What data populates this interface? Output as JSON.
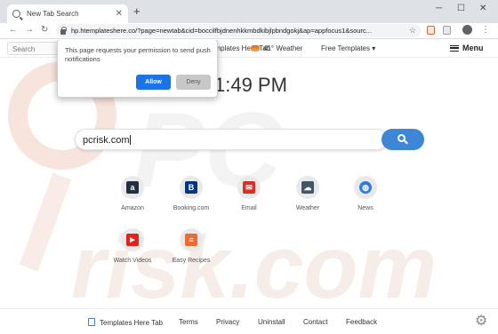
{
  "browser": {
    "tab_title": "New Tab Search",
    "new_tab_glyph": "+",
    "url": "hp.htemplateshere.co/?page=newtab&cid=boccilfbjdnenhkkmbdkibjlpbndgokj&ap=appfocus1&sourc..."
  },
  "popup": {
    "message": "This page requests your permission to send push notifications",
    "allow_label": "Allow",
    "deny_label": "Deny",
    "allow_color": "#1a73e8"
  },
  "topnav": {
    "search_placeholder": "Search",
    "brand": "Templates Here Tab",
    "weather": "41° Weather",
    "free_templates": "Free Templates ▾",
    "menu": "Menu"
  },
  "clock": "1:49 PM",
  "search": {
    "value": "pcrisk.com",
    "button_color": "#3d86d8"
  },
  "tiles": [
    {
      "label": "Amazon",
      "icon": "amazon-icon",
      "glyph": "a",
      "color": "#232f3e"
    },
    {
      "label": "Booking.com",
      "icon": "booking-icon",
      "glyph": "B",
      "color": "#003580"
    },
    {
      "label": "Email",
      "icon": "email-icon",
      "glyph": "✉",
      "color": "#d93025"
    },
    {
      "label": "Weather",
      "icon": "weather-icon",
      "glyph": "☁",
      "color": "#445566"
    },
    {
      "label": "News",
      "icon": "globe-icon",
      "glyph": "◍",
      "color": "#2b7de9"
    },
    {
      "label": "Watch Videos",
      "icon": "youtube-icon",
      "glyph": "▶",
      "color": "#e62117"
    },
    {
      "label": "Easy Recipes",
      "icon": "recipes-icon",
      "glyph": "≡",
      "color": "#ef6a2c"
    }
  ],
  "footer": {
    "brand": "Templates Here Tab",
    "terms": "Terms",
    "privacy": "Privacy",
    "uninstall": "Uninstall",
    "contact": "Contact",
    "feedback": "Feedback"
  }
}
